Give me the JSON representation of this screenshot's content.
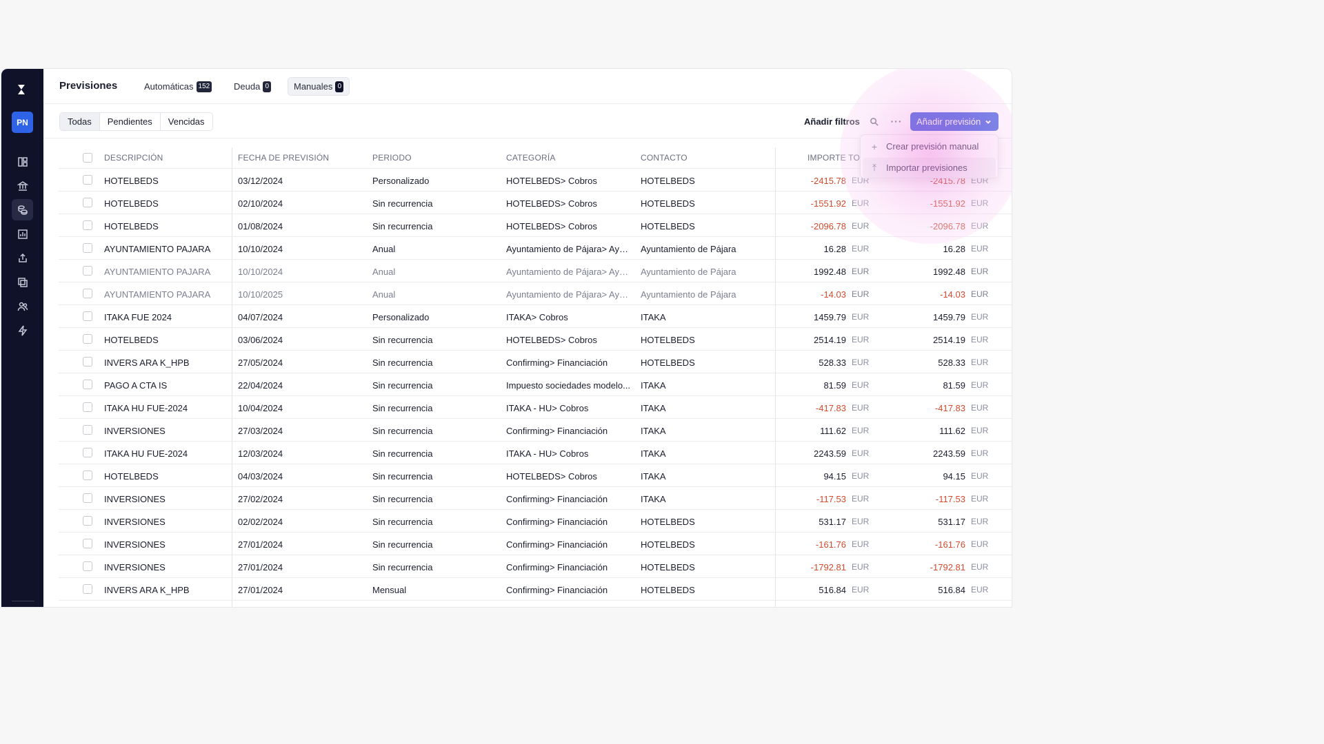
{
  "app": {
    "title": "Previsiones",
    "user_initials": "PN",
    "tabs": [
      {
        "label": "Automáticas",
        "count": "152"
      },
      {
        "label": "Deuda",
        "count": "0"
      },
      {
        "label": "Manuales",
        "count": "0",
        "active": true
      }
    ],
    "sidebar_icons": [
      "dashboard-icon",
      "bank-icon",
      "forecast-icon",
      "chart-icon",
      "upload-icon",
      "copy-icon",
      "users-icon",
      "lightning-icon"
    ]
  },
  "toolbar": {
    "segments": [
      "Todas",
      "Pendientes",
      "Vencidas"
    ],
    "active_segment": "Todas",
    "filters_label": "Añadir filtros",
    "more_label": "···",
    "add_label": "Añadir previsión"
  },
  "dropdown": {
    "items": [
      {
        "icon": "plus-icon",
        "glyph": "+",
        "label": "Crear previsión manual"
      },
      {
        "icon": "upload-icon",
        "glyph": "⤒",
        "label": "Importar previsiones"
      }
    ]
  },
  "table": {
    "columns": [
      "DESCRIPCIÓN",
      "FECHA DE PREVISIÓN",
      "PERIODO",
      "CATEGORÍA",
      "CONTACTO",
      "IMPORTE TOTA"
    ],
    "rows": [
      {
        "desc": "HOTELBEDS",
        "date": "03/12/2024",
        "period": "Personalizado",
        "cat": "HOTELBEDS> Cobros",
        "contact": "HOTELBEDS",
        "amount": "-2415.78",
        "amount2": "-2415.78",
        "cur": "EUR"
      },
      {
        "desc": "HOTELBEDS",
        "date": "02/10/2024",
        "period": "Sin recurrencia",
        "cat": "HOTELBEDS> Cobros",
        "contact": "HOTELBEDS",
        "amount": "-1551.92",
        "amount2": "-1551.92",
        "cur": "EUR"
      },
      {
        "desc": "HOTELBEDS",
        "date": "01/08/2024",
        "period": "Sin recurrencia",
        "cat": "HOTELBEDS> Cobros",
        "contact": "HOTELBEDS",
        "amount": "-2096.78",
        "amount2": "-2096.78",
        "cur": "EUR"
      },
      {
        "desc": "AYUNTAMIENTO PAJARA",
        "date": "10/10/2024",
        "period": "Anual",
        "cat": "Ayuntamiento de Pájara> Ayun...",
        "contact": "Ayuntamiento de Pájara",
        "amount": "16.28",
        "amount2": "16.28",
        "cur": "EUR"
      },
      {
        "desc": "AYUNTAMIENTO PAJARA",
        "date": "10/10/2024",
        "period": "Anual",
        "cat": "Ayuntamiento de Pájara> Ayun...",
        "contact": "Ayuntamiento de Pájara",
        "amount": "1992.48",
        "amount2": "1992.48",
        "cur": "EUR",
        "muted": true
      },
      {
        "desc": "AYUNTAMIENTO PAJARA",
        "date": "10/10/2025",
        "period": "Anual",
        "cat": "Ayuntamiento de Pájara> Ayun...",
        "contact": "Ayuntamiento de Pájara",
        "amount": "-14.03",
        "amount2": "-14.03",
        "cur": "EUR",
        "muted": true
      },
      {
        "desc": "ITAKA FUE 2024",
        "date": "04/07/2024",
        "period": "Personalizado",
        "cat": "ITAKA> Cobros",
        "contact": "ITAKA",
        "amount": "1459.79",
        "amount2": "1459.79",
        "cur": "EUR"
      },
      {
        "desc": "HOTELBEDS",
        "date": "03/06/2024",
        "period": "Sin recurrencia",
        "cat": "HOTELBEDS> Cobros",
        "contact": "HOTELBEDS",
        "amount": "2514.19",
        "amount2": "2514.19",
        "cur": "EUR"
      },
      {
        "desc": "INVERS ARA K_HPB",
        "date": "27/05/2024",
        "period": "Sin recurrencia",
        "cat": "Confirming> Financiación",
        "contact": "HOTELBEDS",
        "amount": "528.33",
        "amount2": "528.33",
        "cur": "EUR"
      },
      {
        "desc": "PAGO A CTA IS",
        "date": "22/04/2024",
        "period": "Sin recurrencia",
        "cat": "Impuesto sociedades modelo...",
        "contact": "ITAKA",
        "amount": "81.59",
        "amount2": "81.59",
        "cur": "EUR"
      },
      {
        "desc": "ITAKA HU FUE-2024",
        "date": "10/04/2024",
        "period": "Sin recurrencia",
        "cat": "ITAKA - HU> Cobros",
        "contact": "ITAKA",
        "amount": "-417.83",
        "amount2": "-417.83",
        "cur": "EUR"
      },
      {
        "desc": "INVERSIONES",
        "date": "27/03/2024",
        "period": "Sin recurrencia",
        "cat": "Confirming> Financiación",
        "contact": "ITAKA",
        "amount": "111.62",
        "amount2": "111.62",
        "cur": "EUR"
      },
      {
        "desc": "ITAKA HU FUE-2024",
        "date": "12/03/2024",
        "period": "Sin recurrencia",
        "cat": "ITAKA - HU> Cobros",
        "contact": "ITAKA",
        "amount": "2243.59",
        "amount2": "2243.59",
        "cur": "EUR"
      },
      {
        "desc": "HOTELBEDS",
        "date": "04/03/2024",
        "period": "Sin recurrencia",
        "cat": "HOTELBEDS> Cobros",
        "contact": "ITAKA",
        "amount": "94.15",
        "amount2": "94.15",
        "cur": "EUR"
      },
      {
        "desc": "INVERSIONES",
        "date": "27/02/2024",
        "period": "Sin recurrencia",
        "cat": "Confirming> Financiación",
        "contact": "ITAKA",
        "amount": "-117.53",
        "amount2": "-117.53",
        "cur": "EUR"
      },
      {
        "desc": "INVERSIONES",
        "date": "02/02/2024",
        "period": "Sin recurrencia",
        "cat": "Confirming> Financiación",
        "contact": "HOTELBEDS",
        "amount": "531.17",
        "amount2": "531.17",
        "cur": "EUR"
      },
      {
        "desc": "INVERSIONES",
        "date": "27/01/2024",
        "period": "Sin recurrencia",
        "cat": "Confirming> Financiación",
        "contact": "HOTELBEDS",
        "amount": "-161.76",
        "amount2": "-161.76",
        "cur": "EUR"
      },
      {
        "desc": "INVERSIONES",
        "date": "27/01/2024",
        "period": "Sin recurrencia",
        "cat": "Confirming> Financiación",
        "contact": "HOTELBEDS",
        "amount": "-1792.81",
        "amount2": "-1792.81",
        "cur": "EUR"
      },
      {
        "desc": "INVERS ARA K_HPB",
        "date": "27/01/2024",
        "period": "Mensual",
        "cat": "Confirming> Financiación",
        "contact": "HOTELBEDS",
        "amount": "516.84",
        "amount2": "516.84",
        "cur": "EUR"
      }
    ]
  },
  "colors": {
    "accent": "#3c5be0",
    "sidebar": "#0f1228",
    "negative": "#d24a2d",
    "highlight": "#f2a8e8"
  }
}
